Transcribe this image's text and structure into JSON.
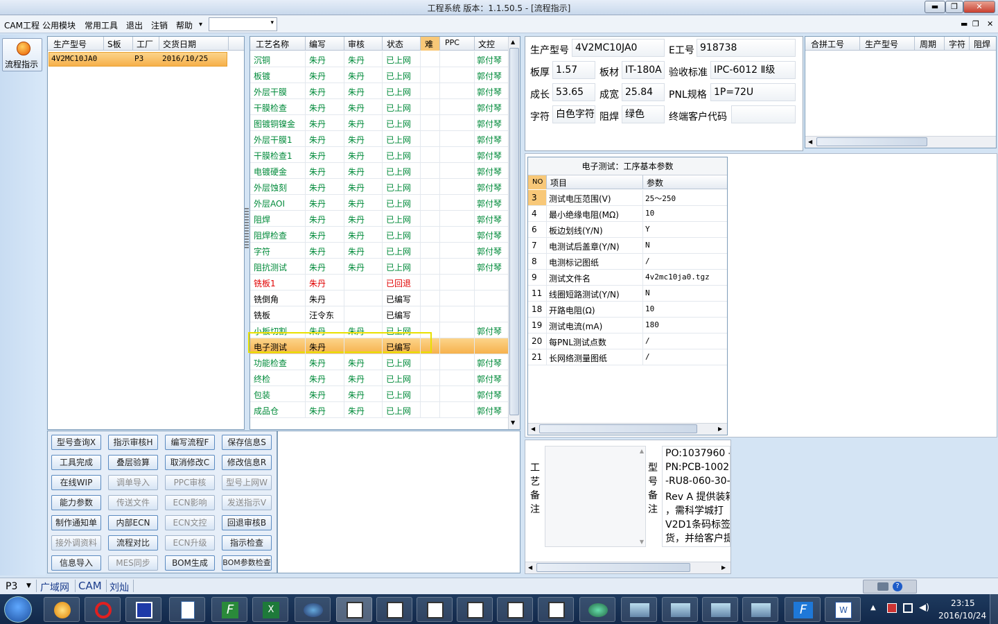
{
  "window": {
    "title": "工程系统    版本：1.1.50.5 - [流程指示]",
    "min": "▬",
    "max": "❐",
    "close": "✕"
  },
  "menu": {
    "items": [
      "CAM工程",
      "公用模块",
      "常用工具",
      "退出",
      "注销",
      "帮助"
    ],
    "help_arrow": "▾",
    "combo_value": "",
    "combo_arrow": "▾",
    "restore": "❐",
    "close2": "✕",
    "minimize2": "▬"
  },
  "nav": {
    "flow_label": "流程指示"
  },
  "jobs": {
    "headers": [
      "生产型号",
      "S板",
      "工厂",
      "交货日期"
    ],
    "rows": [
      {
        "model": "4V2MC10JA0",
        "s": "",
        "factory": "P3",
        "date": "2016/10/25"
      }
    ]
  },
  "process": {
    "headers": [
      "工艺名称",
      "编写",
      "审核",
      "状态",
      "难",
      "PPC",
      "文控"
    ],
    "rows": [
      {
        "name": "沉铜",
        "writer": "朱丹",
        "review": "朱丹",
        "status": "已上网",
        "doc": "郭付琴",
        "color": "green"
      },
      {
        "name": "板镀",
        "writer": "朱丹",
        "review": "朱丹",
        "status": "已上网",
        "doc": "郭付琴",
        "color": "green"
      },
      {
        "name": "外层干膜",
        "writer": "朱丹",
        "review": "朱丹",
        "status": "已上网",
        "doc": "郭付琴",
        "color": "green"
      },
      {
        "name": "干膜检查",
        "writer": "朱丹",
        "review": "朱丹",
        "status": "已上网",
        "doc": "郭付琴",
        "color": "green"
      },
      {
        "name": "图镀铜镍金",
        "writer": "朱丹",
        "review": "朱丹",
        "status": "已上网",
        "doc": "郭付琴",
        "color": "green"
      },
      {
        "name": "外层干膜1",
        "writer": "朱丹",
        "review": "朱丹",
        "status": "已上网",
        "doc": "郭付琴",
        "color": "green"
      },
      {
        "name": "干膜检查1",
        "writer": "朱丹",
        "review": "朱丹",
        "status": "已上网",
        "doc": "郭付琴",
        "color": "green"
      },
      {
        "name": "电镀硬金",
        "writer": "朱丹",
        "review": "朱丹",
        "status": "已上网",
        "doc": "郭付琴",
        "color": "green"
      },
      {
        "name": "外层蚀刻",
        "writer": "朱丹",
        "review": "朱丹",
        "status": "已上网",
        "doc": "郭付琴",
        "color": "green"
      },
      {
        "name": "外层AOI",
        "writer": "朱丹",
        "review": "朱丹",
        "status": "已上网",
        "doc": "郭付琴",
        "color": "green"
      },
      {
        "name": "阻焊",
        "writer": "朱丹",
        "review": "朱丹",
        "status": "已上网",
        "doc": "郭付琴",
        "color": "green"
      },
      {
        "name": "阻焊检查",
        "writer": "朱丹",
        "review": "朱丹",
        "status": "已上网",
        "doc": "郭付琴",
        "color": "green"
      },
      {
        "name": "字符",
        "writer": "朱丹",
        "review": "朱丹",
        "status": "已上网",
        "doc": "郭付琴",
        "color": "green"
      },
      {
        "name": "阻抗测试",
        "writer": "朱丹",
        "review": "朱丹",
        "status": "已上网",
        "doc": "郭付琴",
        "color": "green"
      },
      {
        "name": "铣板1",
        "writer": "朱丹",
        "review": "",
        "status": "已回退",
        "doc": "",
        "color": "red"
      },
      {
        "name": "铣倒角",
        "writer": "朱丹",
        "review": "",
        "status": "已编写",
        "doc": "",
        "color": "blk"
      },
      {
        "name": "铣板",
        "writer": "汪令东",
        "review": "",
        "status": "已编写",
        "doc": "",
        "color": "blk"
      },
      {
        "name": "小板切割",
        "writer": "朱丹",
        "review": "朱丹",
        "status": "已上网",
        "doc": "郭付琴",
        "color": "green"
      },
      {
        "name": "电子测试",
        "writer": "朱丹",
        "review": "",
        "status": "已编写",
        "doc": "",
        "color": "blk",
        "selected": true
      },
      {
        "name": "功能检查",
        "writer": "朱丹",
        "review": "朱丹",
        "status": "已上网",
        "doc": "郭付琴",
        "color": "green"
      },
      {
        "name": "终检",
        "writer": "朱丹",
        "review": "朱丹",
        "status": "已上网",
        "doc": "郭付琴",
        "color": "green"
      },
      {
        "name": "包装",
        "writer": "朱丹",
        "review": "朱丹",
        "status": "已上网",
        "doc": "郭付琴",
        "color": "green"
      },
      {
        "name": "成品仓",
        "writer": "朱丹",
        "review": "朱丹",
        "status": "已上网",
        "doc": "郭付琴",
        "color": "green"
      }
    ]
  },
  "buttons": [
    [
      "型号查询X",
      "指示审核H",
      "编写流程F",
      "保存信息S"
    ],
    [
      "工具完成",
      "叠层验算",
      "取消修改C",
      "修改信息R"
    ],
    [
      "在线WIP",
      "调单导入",
      "PPC审核",
      "型号上网W"
    ],
    [
      "能力参数",
      "传送文件",
      "ECN影响",
      "发送指示V"
    ],
    [
      "制作通知单",
      "内部ECN",
      "ECN文控",
      "回退审核B"
    ],
    [
      "接外调资料",
      "流程对比",
      "ECN升级",
      "指示检查"
    ],
    [
      "信息导入",
      "MES同步",
      "BOM生成",
      "BOM参数检查"
    ]
  ],
  "buttons_disabled": [
    [
      false,
      false,
      false,
      false
    ],
    [
      false,
      false,
      false,
      false
    ],
    [
      false,
      true,
      true,
      true
    ],
    [
      false,
      true,
      true,
      true
    ],
    [
      false,
      false,
      true,
      false
    ],
    [
      true,
      false,
      true,
      false
    ],
    [
      false,
      true,
      false,
      false
    ]
  ],
  "info": {
    "model_label": "生产型号",
    "model": "4V2MC10JA0",
    "eno_label": "E工号",
    "eno": "918738",
    "thick_label": "板厚",
    "thick": "1.57",
    "material_label": "板材",
    "material": "IT-180A",
    "std_label": "验收标准",
    "std": "IPC-6012 Ⅱ级",
    "len_label": "成长",
    "len": "53.65",
    "wid_label": "成宽",
    "wid": "25.84",
    "pnl_label": "PNL规格",
    "pnl": "1P=72U",
    "char_label": "字符",
    "char": "白色字符",
    "mask_label": "阻焊",
    "mask": "绿色",
    "cust_label": "终端客户代码",
    "cust": ""
  },
  "merge": {
    "headers": [
      "合拼工号",
      "生产型号",
      "周期",
      "字符",
      "阻焊"
    ]
  },
  "params": {
    "title": "电子测试：工序基本参数",
    "headers": [
      "NO",
      "项目",
      "参数"
    ],
    "rows": [
      {
        "no": "3",
        "item": "测试电压范围(V)",
        "val": "25～250"
      },
      {
        "no": "4",
        "item": "最小绝缘电阻(MΩ)",
        "val": "10"
      },
      {
        "no": "6",
        "item": "板边划线(Y/N)",
        "val": "Y"
      },
      {
        "no": "7",
        "item": "电测试后盖章(Y/N)",
        "val": "N"
      },
      {
        "no": "8",
        "item": "电测标记图纸",
        "val": "/"
      },
      {
        "no": "9",
        "item": "测试文件名",
        "val": "4v2mc10ja0.tgz"
      },
      {
        "no": "11",
        "item": "线圈短路测试(Y/N)",
        "val": "N"
      },
      {
        "no": "18",
        "item": "开路电阻(Ω)",
        "val": "10"
      },
      {
        "no": "19",
        "item": "测试电流(mA)",
        "val": "180"
      },
      {
        "no": "20",
        "item": "每PNL测试点数",
        "val": "/"
      },
      {
        "no": "21",
        "item": "长网络测量图纸",
        "val": "/"
      }
    ]
  },
  "remarks": {
    "process_label": [
      "工",
      "艺",
      "备",
      "注"
    ],
    "model_label": [
      "型",
      "号",
      "备",
      "注"
    ],
    "model_text": [
      "PO:1037960 -",
      "PN:PCB-10025",
      "-RU8-060-30-S",
      "Rev A  提供装箱",
      "，需科学城打",
      "V2D1条码标签",
      "货，并给客户提"
    ]
  },
  "status": {
    "factory": "P3",
    "net": "广域网",
    "cam": "CAM",
    "user": "刘灿"
  },
  "tray": {
    "time": "23:15",
    "date": "2016/10/24"
  },
  "colors": {
    "selected_row": "#fbc270",
    "selected_border": "#e8e000",
    "green_text": "#008a3a",
    "red_text": "#e00000"
  }
}
